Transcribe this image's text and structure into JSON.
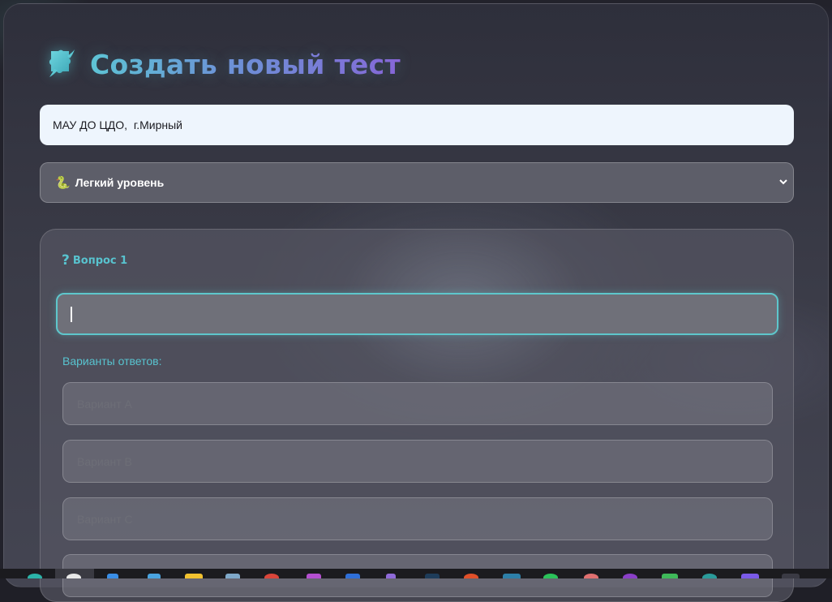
{
  "header": {
    "title": "Создать новый тест",
    "icon": "puzzle-icon"
  },
  "organization_field": {
    "value": "МАУ ДО ЦДО,  г.Мирный"
  },
  "level_select": {
    "selected": "Легкий уровень",
    "icon": "snake-icon"
  },
  "question": {
    "label": "Вопрос 1",
    "icon": "question-mark-icon",
    "value": ""
  },
  "answers": {
    "label": "Варианты ответов:",
    "options": [
      {
        "placeholder": "Вариант A"
      },
      {
        "placeholder": "Вариант B"
      },
      {
        "placeholder": "Вариант C"
      },
      {
        "placeholder": ""
      }
    ]
  },
  "colors": {
    "accent_teal": "#58c3cf",
    "accent_purple": "#8a62d8",
    "panel_bg": "#3a3b47"
  }
}
